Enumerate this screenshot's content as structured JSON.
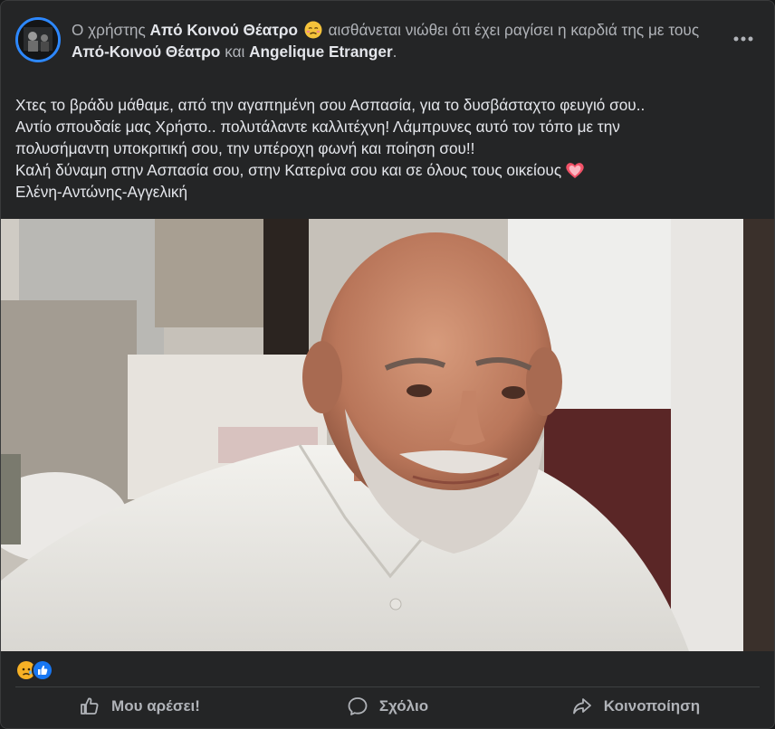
{
  "post": {
    "header": {
      "prefix": "Ο χρήστης",
      "author": "Από Κοινού Θέατρο",
      "feeling": "αισθάνεται νιώθει ότι έχει ραγίσει η καρδιά της",
      "with_text": "με τους",
      "tagged_1": "Από-Κοινού Θέατρο",
      "and_text": "και",
      "tagged_2": "Angelique Etranger",
      "end": "."
    },
    "body": [
      "Χτες το βράδυ μάθαμε, από την αγαπημένη σου Ασπασία, για το δυσβάσταχτο φευγιό σου..",
      "Αντίο σπουδαίε μας Χρήστο.. πολυτάλαντε καλλιτέχνη! Λάμπρυνες αυτό τον τόπο με την",
      "πολυσήμαντη υποκριτική σου, την υπέροχη φωνή και ποίηση σου!!",
      "Καλή δύναμη στην Ασπασία σου, στην Κατερίνα σου και σε όλους τους οικείους",
      "Ελένη-Αντώνης-Αγγελική"
    ],
    "reactions": [
      "sad-reaction",
      "like-reaction"
    ]
  },
  "actions": {
    "like": "Μου αρέσει!",
    "comment": "Σχόλιο",
    "share": "Κοινοποίηση"
  },
  "colors": {
    "card_bg": "#242526",
    "primary_text": "#e4e6eb",
    "secondary_text": "#b0b3b8",
    "accent": "#2d88ff"
  }
}
